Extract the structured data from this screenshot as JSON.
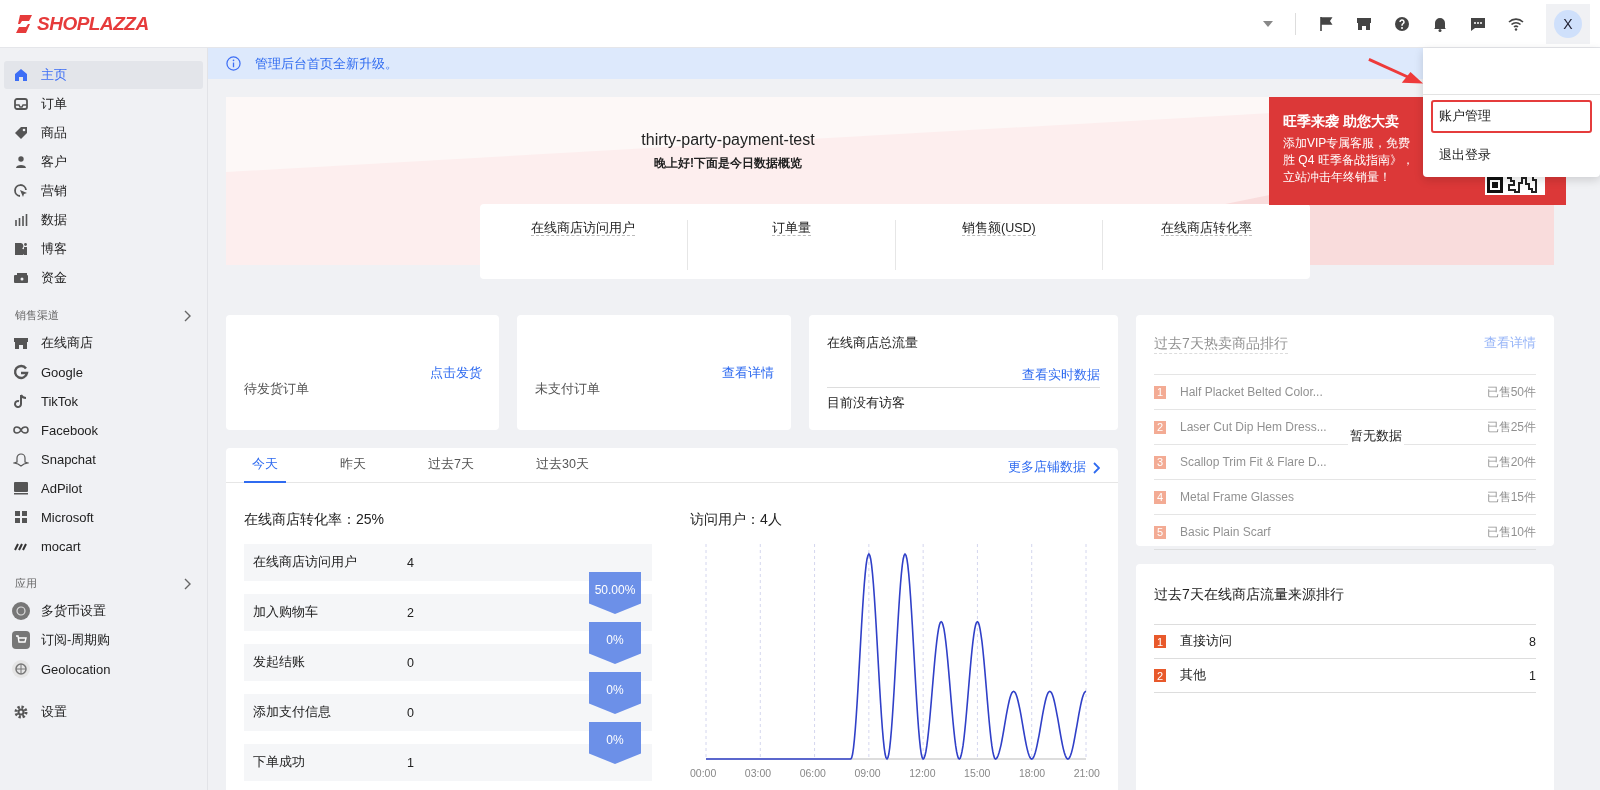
{
  "top_bar": {
    "logo": "SHOPLAZZA",
    "avatar": "X"
  },
  "account_menu": {
    "items": [
      {
        "label": "账户管理",
        "highlighted": true
      },
      {
        "label": "退出登录",
        "highlighted": false
      }
    ]
  },
  "sidebar": {
    "main_items": [
      {
        "label": "主页",
        "selected": true
      },
      {
        "label": "订单",
        "selected": false
      },
      {
        "label": "商品",
        "selected": false
      },
      {
        "label": "客户",
        "selected": false
      },
      {
        "label": "营销",
        "selected": false
      },
      {
        "label": "数据",
        "selected": false
      },
      {
        "label": "博客",
        "selected": false
      },
      {
        "label": "资金",
        "selected": false
      }
    ],
    "sections": [
      {
        "title": "销售渠道",
        "items": [
          {
            "label": "在线商店",
            "selected": false
          },
          {
            "label": "Google",
            "selected": false
          },
          {
            "label": "TikTok",
            "selected": false
          },
          {
            "label": "Facebook",
            "selected": false
          },
          {
            "label": "Snapchat",
            "selected": false
          },
          {
            "label": "AdPilot",
            "selected": false
          },
          {
            "label": "Microsoft",
            "selected": false
          },
          {
            "label": "mocart",
            "selected": false
          }
        ]
      },
      {
        "title": "应用",
        "items": [
          {
            "label": "多货币设置",
            "selected": false
          },
          {
            "label": "订阅-周期购",
            "selected": false
          },
          {
            "label": "Geolocation",
            "selected": false
          }
        ]
      }
    ],
    "settings": {
      "label": "设置",
      "selected": false
    }
  },
  "notice": "管理后台首页全新升级。",
  "hero": {
    "store_name": "thirty-party-payment-test",
    "greeting": "晚上好!下面是今日数据概览",
    "stats": [
      {
        "label": "在线商店访问用户"
      },
      {
        "label": "订单量"
      },
      {
        "label": "销售额(USD)"
      },
      {
        "label": "在线商店转化率"
      }
    ]
  },
  "promo": {
    "title": "旺季来袭 助您大卖",
    "lines": [
      "添加VIP专属客服，免费",
      "胜 Q4 旺季备战指南》，",
      "立站冲击年终销量！"
    ]
  },
  "summary_cards": [
    {
      "label": "待发货订单",
      "link": "点击发货"
    },
    {
      "label": "未支付订单",
      "link": "查看详情"
    }
  ],
  "traffic_card": {
    "title": "在线商店总流量",
    "link": "查看实时数据",
    "note": "目前没有访客"
  },
  "tabs": [
    {
      "label": "今天",
      "selected": true
    },
    {
      "label": "昨天",
      "selected": false
    },
    {
      "label": "过去7天",
      "selected": false
    },
    {
      "label": "过去30天",
      "selected": false
    }
  ],
  "more_link": "更多店铺数据",
  "funnel": {
    "title": "在线商店转化率：25%",
    "steps": [
      {
        "label": "在线商店访问用户",
        "value": "4"
      },
      {
        "label": "加入购物车",
        "value": "2"
      },
      {
        "label": "发起结账",
        "value": "0"
      },
      {
        "label": "添加支付信息",
        "value": "0"
      },
      {
        "label": "下单成功",
        "value": "1"
      }
    ],
    "rates": [
      "50.00%",
      "0%",
      "0%",
      "0%"
    ]
  },
  "visitors": {
    "title": "访问用户：4人",
    "x_labels": [
      "00:00",
      "03:00",
      "06:00",
      "09:00",
      "12:00",
      "15:00",
      "18:00",
      "21:00"
    ]
  },
  "hot_products": {
    "title": "过去7天热卖商品排行",
    "link": "查看详情",
    "faded": true,
    "empty_text": "暂无数据",
    "rows": [
      {
        "rank": "1",
        "name": "Half Placket Belted Color...",
        "sold": "已售50件"
      },
      {
        "rank": "2",
        "name": "Laser Cut Dip Hem Dress...",
        "sold": "已售25件"
      },
      {
        "rank": "3",
        "name": "Scallop Trim Fit & Flare D...",
        "sold": "已售20件"
      },
      {
        "rank": "4",
        "name": "Metal Frame Glasses",
        "sold": "已售15件"
      },
      {
        "rank": "5",
        "name": "Basic Plain Scarf",
        "sold": "已售10件"
      }
    ]
  },
  "traffic_sources": {
    "title": "过去7天在线商店流量来源排行",
    "rows": [
      {
        "rank": "1",
        "name": "直接访问",
        "value": "8"
      },
      {
        "rank": "2",
        "name": "其他",
        "value": "1"
      }
    ]
  }
}
